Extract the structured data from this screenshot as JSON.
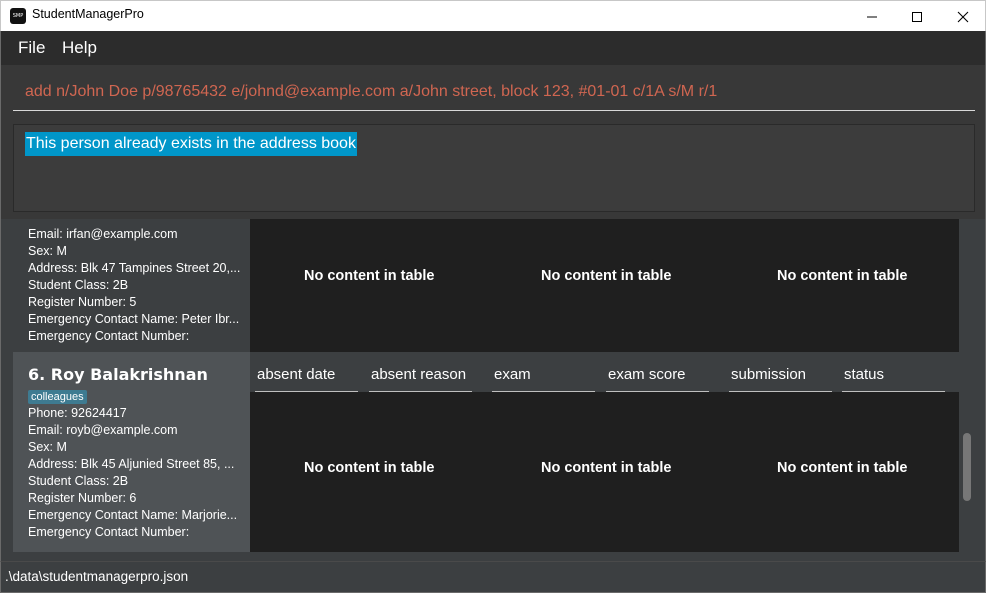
{
  "window": {
    "title": "StudentManagerPro",
    "icon_text": "SMP",
    "controls": [
      "minimize-icon",
      "maximize-icon",
      "close-icon"
    ]
  },
  "menu": {
    "items": [
      {
        "label": "File"
      },
      {
        "label": "Help"
      }
    ]
  },
  "command": {
    "value": "add n/John Doe p/98765432 e/johnd@example.com a/John street, block 123, #01-01 c/1A s/M r/1",
    "color": "#d06651"
  },
  "result": {
    "message": "This person already exists in the address book",
    "highlight_color": "#0096c9"
  },
  "persons": [
    {
      "fields": [
        "Email: irfan@example.com",
        "Sex: M",
        "Address: Blk 47 Tampines Street 20,...",
        "Student Class: 2B",
        "Register Number: 5",
        "Emergency Contact Name: Peter Ibr...",
        "Emergency Contact Number:"
      ],
      "tables_empty": [
        "No content in table",
        "No content in table",
        "No content in table"
      ]
    },
    {
      "name": "6.  Roy Balakrishnan",
      "tag": "colleagues",
      "fields": [
        "Phone: 92624417",
        "Email: royb@example.com",
        "Sex: M",
        "Address: Blk 45 Aljunied Street 85, ...",
        "Student Class: 2B",
        "Register Number: 6",
        "Emergency Contact Name: Marjorie...",
        "Emergency Contact Number:"
      ],
      "columns": [
        "absent date",
        "absent reason",
        "exam",
        "exam score",
        "submission",
        "status"
      ],
      "tables_empty": [
        "No content in table",
        "No content in table",
        "No content in table"
      ]
    }
  ],
  "status": {
    "path": ".\\data\\studentmanagerpro.json"
  }
}
